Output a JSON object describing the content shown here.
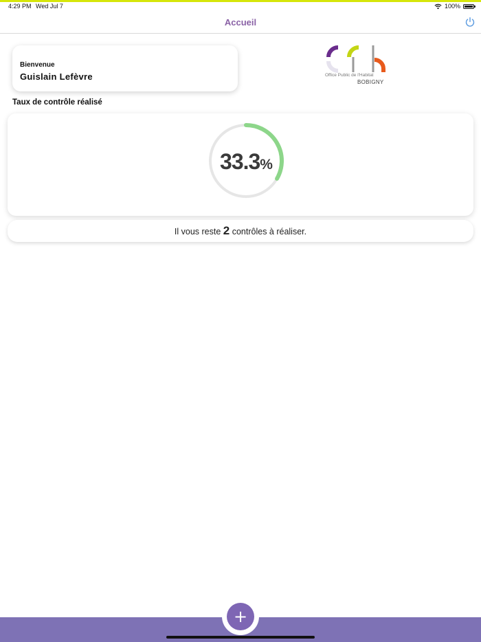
{
  "status_bar": {
    "time": "4:29 PM",
    "date": "Wed Jul 7",
    "battery": "100%"
  },
  "nav": {
    "title": "Accueil",
    "logout_icon": "power-icon"
  },
  "welcome": {
    "greeting": "Bienvenue",
    "user_name": "Guislain Lefèvre"
  },
  "logo": {
    "tagline": "Office Public de l'Habitat",
    "city": "BOBIGNY"
  },
  "progress": {
    "section_title": "Taux de contrôle réalisé",
    "value": "33.3",
    "unit": "%",
    "fraction": 0.333,
    "track_color": "#e6e6e6",
    "progress_color": "#8dd68a"
  },
  "remaining": {
    "prefix": "Il vous reste",
    "count": "2",
    "suffix": "contrôles à réaliser."
  },
  "bottom": {
    "add_icon": "plus-icon",
    "bar_color": "#7e72b5"
  }
}
